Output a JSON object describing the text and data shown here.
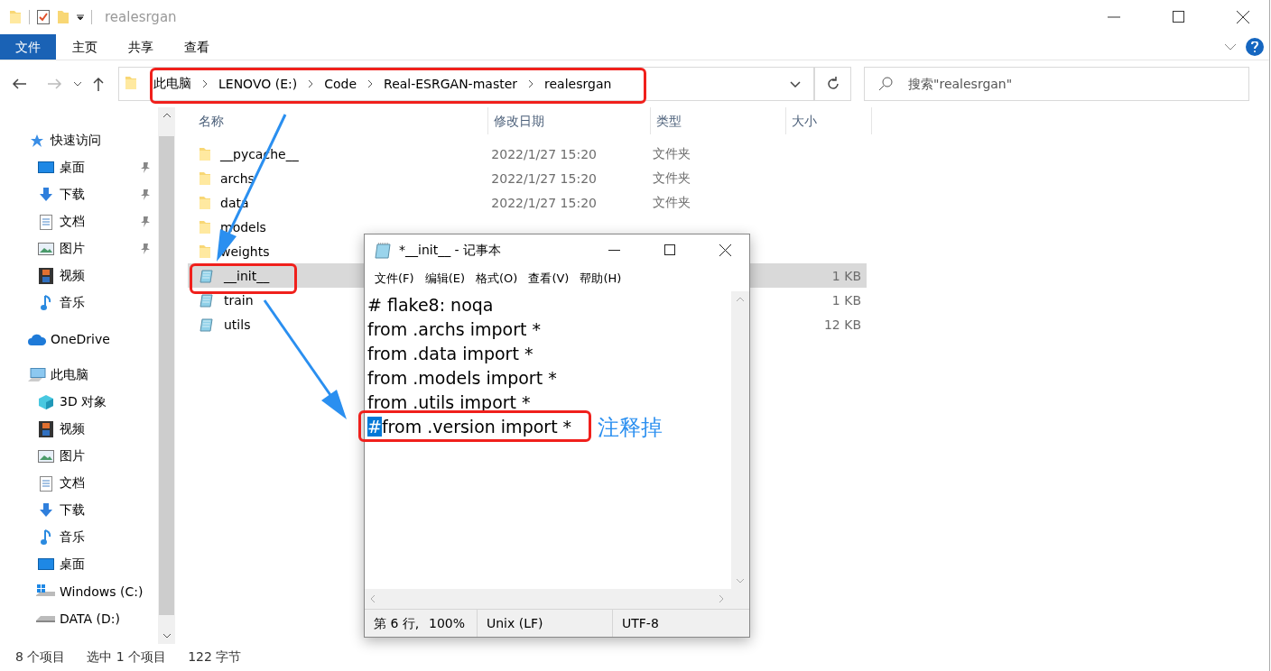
{
  "window": {
    "title": "realesrgan"
  },
  "ribbon": {
    "tabs": [
      {
        "label": "文件",
        "selected": true
      },
      {
        "label": "主页",
        "selected": false
      },
      {
        "label": "共享",
        "selected": false
      },
      {
        "label": "查看",
        "selected": false
      }
    ]
  },
  "address_bar": {
    "crumbs": [
      "此电脑",
      "LENOVO (E:)",
      "Code",
      "Real-ESRGAN-master",
      "realesrgan"
    ]
  },
  "search": {
    "placeholder": "搜索\"realesrgan\""
  },
  "sidebar": {
    "items": [
      {
        "label": "快速访问",
        "kind": "star",
        "children": [
          {
            "label": "桌面",
            "kind": "desktop",
            "pinned": true
          },
          {
            "label": "下载",
            "kind": "download",
            "pinned": true
          },
          {
            "label": "文档",
            "kind": "document",
            "pinned": true
          },
          {
            "label": "图片",
            "kind": "picture",
            "pinned": true
          },
          {
            "label": "视频",
            "kind": "video",
            "pinned": false
          },
          {
            "label": "音乐",
            "kind": "music",
            "pinned": false
          }
        ]
      },
      {
        "label": "OneDrive",
        "kind": "cloud"
      },
      {
        "label": "此电脑",
        "kind": "computer",
        "children": [
          {
            "label": "3D 对象",
            "kind": "cube"
          },
          {
            "label": "视频",
            "kind": "video"
          },
          {
            "label": "图片",
            "kind": "picture"
          },
          {
            "label": "文档",
            "kind": "document"
          },
          {
            "label": "下载",
            "kind": "download"
          },
          {
            "label": "音乐",
            "kind": "music"
          },
          {
            "label": "桌面",
            "kind": "desktop"
          },
          {
            "label": "Windows (C:)",
            "kind": "system-drive"
          },
          {
            "label": "DATA (D:)",
            "kind": "drive"
          }
        ]
      }
    ]
  },
  "file_list": {
    "columns": [
      "名称",
      "修改日期",
      "类型",
      "大小"
    ],
    "rows": [
      {
        "name": "__pycache__",
        "kind": "folder",
        "modified": "2022/1/27 15:20",
        "type": "文件夹",
        "selected": false
      },
      {
        "name": "archs",
        "kind": "folder",
        "modified": "2022/1/27 15:20",
        "type": "文件夹",
        "selected": false
      },
      {
        "name": "data",
        "kind": "folder",
        "modified": "2022/1/27 15:20",
        "type": "文件夹",
        "selected": false
      },
      {
        "name": "models",
        "kind": "folder",
        "selected": false
      },
      {
        "name": "weights",
        "kind": "folder",
        "selected": false
      },
      {
        "name": "__init__",
        "kind": "file",
        "size": "1 KB",
        "selected": true
      },
      {
        "name": "train",
        "kind": "file",
        "size": "1 KB",
        "selected": false
      },
      {
        "name": "utils",
        "kind": "file",
        "size": "12 KB",
        "selected": false
      }
    ]
  },
  "status_bar": {
    "items": [
      "8 个项目",
      "选中 1 个项目",
      "122 字节"
    ]
  },
  "notepad": {
    "title": "*__init__ - 记事本",
    "menu": [
      "文件(F)",
      "编辑(E)",
      "格式(O)",
      "查看(V)",
      "帮助(H)"
    ],
    "lines": [
      {
        "text": "# flake8: noqa"
      },
      {
        "text": "from .archs import *"
      },
      {
        "text": "from .data import *"
      },
      {
        "text": "from .models import *"
      },
      {
        "text": "from .utils import *"
      },
      {
        "selection": "#",
        "text": "from .version import *"
      }
    ],
    "status": [
      "第 6 行,",
      "100%",
      "Unix (LF)",
      "UTF-8"
    ]
  },
  "annotation": {
    "note": "注释掉"
  }
}
